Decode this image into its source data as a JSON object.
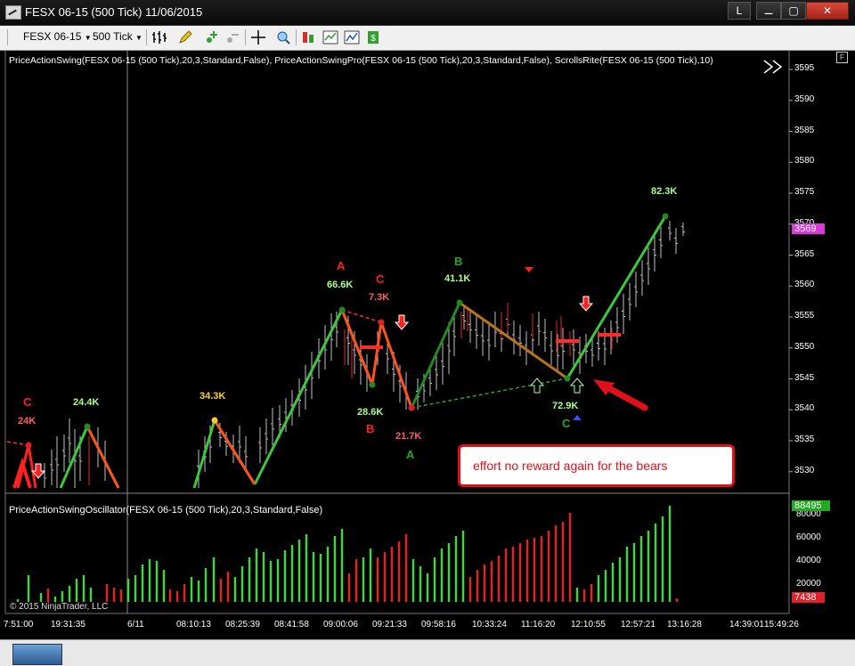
{
  "window": {
    "title": "FESX 06-15 (500 Tick)  11/06/2015",
    "buttons": [
      "L",
      "⚊",
      "▢",
      "✕"
    ]
  },
  "toolbar": {
    "instrument": "FESX 06-15",
    "interval": "500 Tick",
    "icons": [
      "bar-type-icon",
      "pencil-icon",
      "add-indicator-icon",
      "remove-icon",
      "crosshair-icon",
      "zoom-icon",
      "strategy-icon",
      "chart-style-icon",
      "chart-trader-icon",
      "data-box-icon"
    ]
  },
  "price_panel": {
    "indicator_label": "PriceActionSwing(FESX 06-15 (500 Tick),20,3,Standard,False), PriceActionSwingPro(FESX 06-15 (500 Tick),20,3,Standard,False), ScrollsRite(FESX 06-15 (500 Tick),10)",
    "price_ticks": [
      "3595",
      "3590",
      "3585",
      "3580",
      "3575",
      "3570",
      "3565",
      "3560",
      "3555",
      "3550",
      "3545",
      "3540",
      "3535",
      "3530"
    ],
    "current_price": "3569",
    "current_price_color": "#d63bd6",
    "labels": [
      {
        "text": "C",
        "color": "#ff2020"
      },
      {
        "text": "24K",
        "color": "#ff6060"
      },
      {
        "text": "24.4K",
        "color": "#aaff88"
      },
      {
        "text": "34.3K",
        "color": "#ffcc33"
      },
      {
        "text": "A",
        "color": "#ff2020"
      },
      {
        "text": "66.6K",
        "color": "#aaff88"
      },
      {
        "text": "C",
        "color": "#ff2020"
      },
      {
        "text": "7.3K",
        "color": "#ff6060"
      },
      {
        "text": "28.6K",
        "color": "#aaff88"
      },
      {
        "text": "B",
        "color": "#ff2020"
      },
      {
        "text": "21.7K",
        "color": "#ff6060"
      },
      {
        "text": "A",
        "color": "#22aa22"
      },
      {
        "text": "B",
        "color": "#22aa22"
      },
      {
        "text": "41.1K",
        "color": "#aaff88"
      },
      {
        "text": "72.9K",
        "color": "#aaff88"
      },
      {
        "text": "C",
        "color": "#22aa22"
      },
      {
        "text": "82.3K",
        "color": "#aaff88"
      }
    ],
    "callout_text": "effort no reward again for the bears"
  },
  "oscillator_panel": {
    "label": "PriceActionSwingOscillator(FESX 06-15 (500 Tick),20,3,Standard,False)",
    "ticks": [
      "80000",
      "60000",
      "40000",
      "20000"
    ],
    "top_value": "88495",
    "bottom_value": "7438"
  },
  "time_axis": [
    "7:51:00",
    "19:31:35",
    "6/11",
    "08:10:13",
    "08:25:39",
    "08:41:58",
    "09:00:06",
    "09:21:33",
    "09:58:16",
    "10:33:24",
    "11:16:20",
    "12:10:55",
    "12:57:21",
    "13:16:28",
    "14:39:01",
    "15:49:26"
  ],
  "copyright": "© 2015 NinjaTrader, LLC",
  "colors": {
    "up": "#3cc83c",
    "down": "#ff3b1f",
    "neutral_wick": "#b8b8b8"
  }
}
